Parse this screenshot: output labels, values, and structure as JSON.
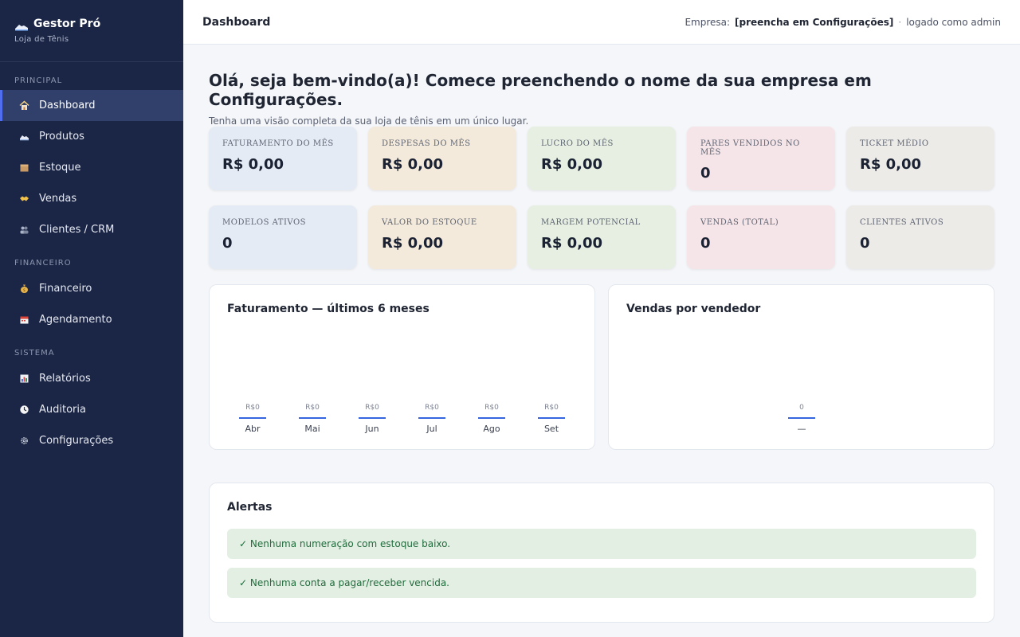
{
  "brand": {
    "title": "Gestor Pró",
    "subtitle": "Loja de Tênis"
  },
  "sidebar": {
    "sections": [
      {
        "label": "PRINCIPAL",
        "items": [
          {
            "label": "Dashboard",
            "icon": "home-icon",
            "active": true
          },
          {
            "label": "Produtos",
            "icon": "shoe-icon"
          },
          {
            "label": "Estoque",
            "icon": "box-icon"
          },
          {
            "label": "Vendas",
            "icon": "handshake-icon"
          },
          {
            "label": "Clientes / CRM",
            "icon": "people-icon"
          }
        ]
      },
      {
        "label": "FINANCEIRO",
        "items": [
          {
            "label": "Financeiro",
            "icon": "money-bag-icon"
          },
          {
            "label": "Agendamento",
            "icon": "calendar-icon"
          }
        ]
      },
      {
        "label": "SISTEMA",
        "items": [
          {
            "label": "Relatórios",
            "icon": "bar-chart-icon"
          },
          {
            "label": "Auditoria",
            "icon": "clock-icon"
          },
          {
            "label": "Configurações",
            "icon": "gear-icon"
          }
        ]
      }
    ]
  },
  "header": {
    "title": "Dashboard",
    "company_prefix": "Empresa:",
    "company_value": "[preencha em Configurações]",
    "separator": "·",
    "user_text": "logado como admin"
  },
  "main": {
    "welcome": "Olá, seja bem-vindo(a)! Comece preenchendo o nome da sua empresa em Configurações.",
    "subtitle": "Tenha uma visão completa da sua loja de tênis em um único lugar.",
    "cards": [
      {
        "label": "FATURAMENTO DO MÊS",
        "value": "R$ 0,00"
      },
      {
        "label": "DESPESAS DO MÊS",
        "value": "R$ 0,00"
      },
      {
        "label": "LUCRO DO MÊS",
        "value": "R$ 0,00"
      },
      {
        "label": "PARES VENDIDOS NO MÊS",
        "value": "0"
      },
      {
        "label": "TICKET MÉDIO",
        "value": "R$ 0,00"
      },
      {
        "label": "MODELOS ATIVOS",
        "value": "0"
      },
      {
        "label": "VALOR DO ESTOQUE",
        "value": "R$ 0,00"
      },
      {
        "label": "MARGEM POTENCIAL",
        "value": "R$ 0,00"
      },
      {
        "label": "VENDAS (TOTAL)",
        "value": "0"
      },
      {
        "label": "CLIENTES ATIVOS",
        "value": "0"
      }
    ],
    "alerts_title": "Alertas",
    "alerts": [
      "✓ Nenhuma numeração com estoque baixo.",
      "✓ Nenhuma conta a pagar/receber vencida."
    ]
  },
  "colors": {
    "sidebar": "#1b2646",
    "accent": "#3566e0",
    "alert_bg": "#e3efe3",
    "alert_text": "#1f6b3b"
  },
  "chart_data": [
    {
      "type": "bar",
      "title": "Faturamento — últimos 6 meses",
      "categories": [
        "Abr",
        "Mai",
        "Jun",
        "Jul",
        "Ago",
        "Set"
      ],
      "values": [
        0,
        0,
        0,
        0,
        0,
        0
      ],
      "value_labels": [
        "R$0",
        "R$0",
        "R$0",
        "R$0",
        "R$0",
        "R$0"
      ]
    },
    {
      "type": "bar",
      "title": "Vendas por vendedor",
      "categories": [
        "—"
      ],
      "values": [
        0
      ],
      "value_labels": [
        "0"
      ]
    }
  ]
}
